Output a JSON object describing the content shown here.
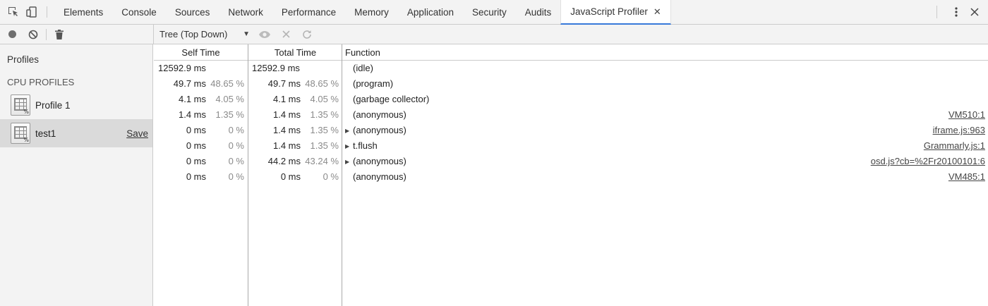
{
  "tabs": [
    {
      "label": "Elements"
    },
    {
      "label": "Console"
    },
    {
      "label": "Sources"
    },
    {
      "label": "Network"
    },
    {
      "label": "Performance"
    },
    {
      "label": "Memory"
    },
    {
      "label": "Application"
    },
    {
      "label": "Security"
    },
    {
      "label": "Audits"
    },
    {
      "label": "JavaScript Profiler",
      "active": true
    }
  ],
  "view_select": {
    "value": "Tree (Top Down)"
  },
  "sidebar": {
    "title": "Profiles",
    "section": "CPU PROFILES",
    "profiles": [
      {
        "label": "Profile 1"
      },
      {
        "label": "test1",
        "save_label": "Save",
        "selected": true
      }
    ]
  },
  "grid": {
    "headers": {
      "self": "Self Time",
      "total": "Total Time",
      "function": "Function"
    },
    "rows": [
      {
        "self": "12592.9 ms",
        "self_pct": "",
        "total": "12592.9 ms",
        "total_pct": "",
        "function": "(idle)",
        "url": "",
        "expandable": false
      },
      {
        "self": "49.7 ms",
        "self_pct": "48.65 %",
        "total": "49.7 ms",
        "total_pct": "48.65 %",
        "function": "(program)",
        "url": "",
        "expandable": false
      },
      {
        "self": "4.1 ms",
        "self_pct": "4.05 %",
        "total": "4.1 ms",
        "total_pct": "4.05 %",
        "function": "(garbage collector)",
        "url": "",
        "expandable": false
      },
      {
        "self": "1.4 ms",
        "self_pct": "1.35 %",
        "total": "1.4 ms",
        "total_pct": "1.35 %",
        "function": "(anonymous)",
        "url": "VM510:1",
        "expandable": false
      },
      {
        "self": "0 ms",
        "self_pct": "0 %",
        "total": "1.4 ms",
        "total_pct": "1.35 %",
        "function": "(anonymous)",
        "url": "iframe.js:963",
        "expandable": true
      },
      {
        "self": "0 ms",
        "self_pct": "0 %",
        "total": "1.4 ms",
        "total_pct": "1.35 %",
        "function": "t.flush",
        "url": "Grammarly.js:1",
        "expandable": true
      },
      {
        "self": "0 ms",
        "self_pct": "0 %",
        "total": "44.2 ms",
        "total_pct": "43.24 %",
        "function": "(anonymous)",
        "url": "osd.js?cb=%2Fr20100101:6",
        "expandable": true
      },
      {
        "self": "0 ms",
        "self_pct": "0 %",
        "total": "0 ms",
        "total_pct": "0 %",
        "function": "(anonymous)",
        "url": "VM485:1",
        "expandable": false
      }
    ]
  },
  "icons": {
    "inspect": "inspect-element-icon",
    "device": "device-toolbar-icon",
    "record": "record-icon",
    "clear": "clear-icon",
    "trash": "trash-icon",
    "focus": "eye-icon",
    "exclude": "close-icon",
    "restore": "reload-icon",
    "more": "kebab-menu-icon",
    "close_devtools": "close-icon",
    "tab_close": "close-icon"
  },
  "tab_close_glyph": "✕"
}
